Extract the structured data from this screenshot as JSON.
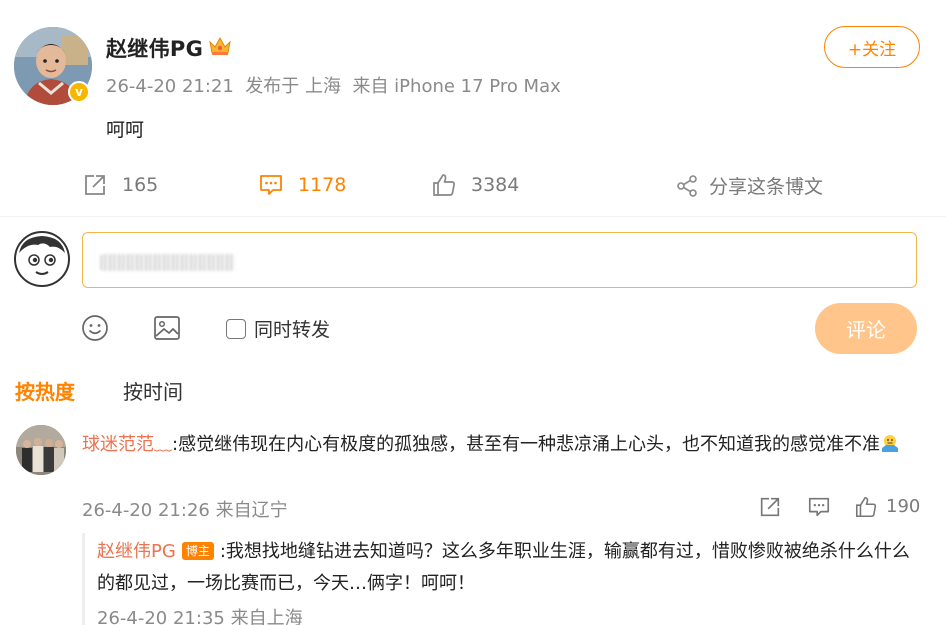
{
  "post": {
    "author": "赵继伟PG",
    "meta": "26-4-20 21:21  发布于 上海  来自 iPhone 17 Pro Max",
    "text": "呵呵",
    "follow_label": "+关注"
  },
  "actions": {
    "repost_count": "165",
    "comment_count": "1178",
    "like_count": "3384",
    "share_label": "分享这条博文"
  },
  "composer": {
    "sync_repost_label": "同时转发",
    "submit_label": "评论"
  },
  "tabs": {
    "hot": "按热度",
    "time": "按时间"
  },
  "comment": {
    "author": "球迷范范﹏",
    "text": ":感觉继伟现在内心有极度的孤独感，甚至有一种悲凉涌上心头，也不知道我的感觉准不准",
    "meta": "26-4-20 21:26 来自辽宁",
    "like_count": "190"
  },
  "reply": {
    "author": "赵继伟PG",
    "tag": "博主",
    "text": ":我想找地缝钻进去知道吗？这么多年职业生涯，输赢都有过，惜败惨败被绝杀什么什么的都见过，一场比赛而已，今天…俩字！呵呵！",
    "meta": "26-4-20 21:35 来自上海"
  },
  "colors": {
    "accent": "#ff8200",
    "name_link": "#eb7350",
    "muted": "#8a8a8a",
    "submit_disabled": "#ffc58a"
  }
}
